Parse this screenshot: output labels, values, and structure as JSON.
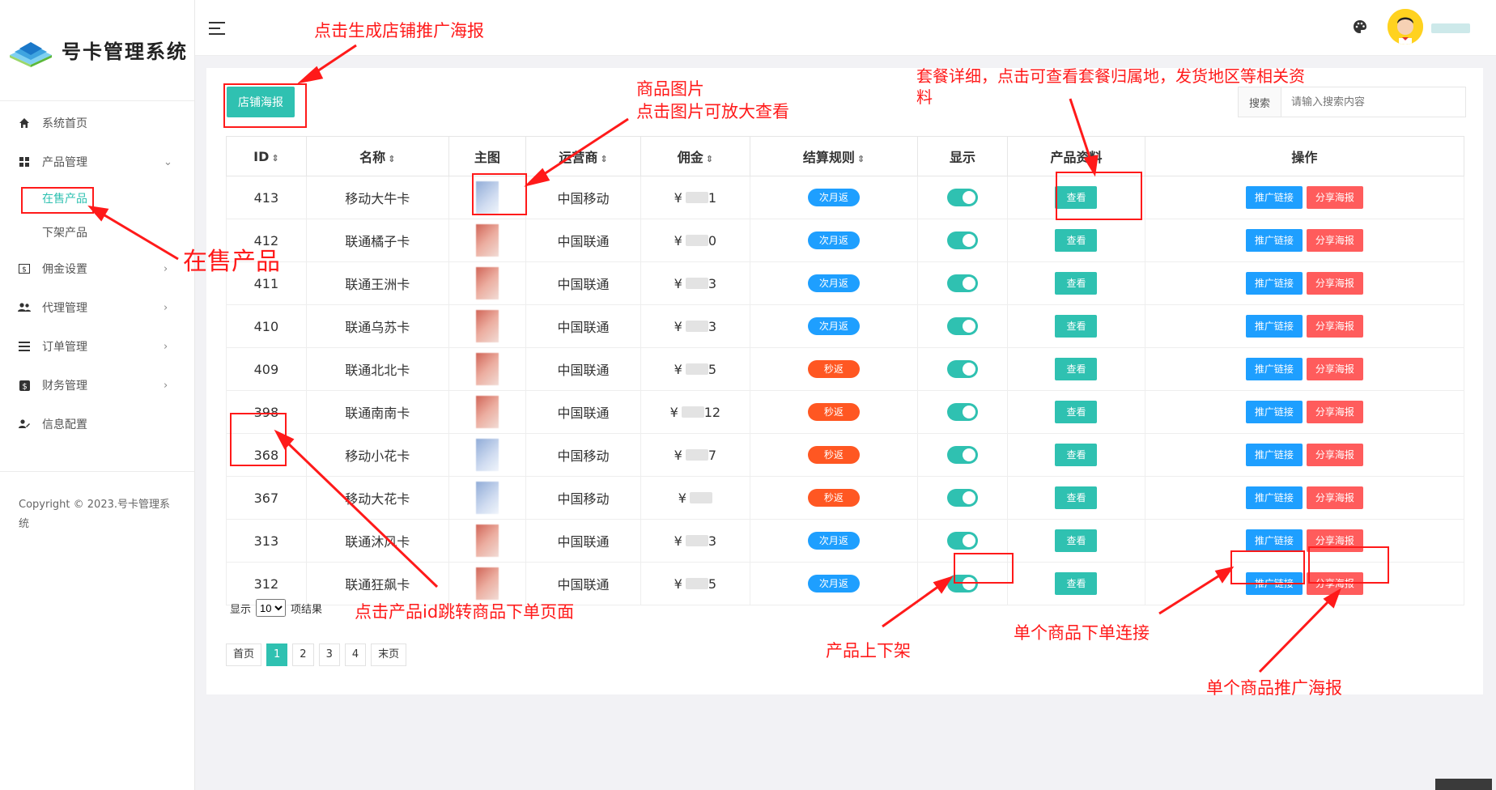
{
  "app": {
    "title": "号卡管理系统"
  },
  "sidebar": {
    "items": [
      {
        "label": "系统首页",
        "icon": "home-icon",
        "arrow": ""
      },
      {
        "label": "产品管理",
        "icon": "grid-icon",
        "arrow": "⌄"
      },
      {
        "label": "佣金设置",
        "icon": "money-icon",
        "arrow": "›"
      },
      {
        "label": "代理管理",
        "icon": "users-icon",
        "arrow": "›"
      },
      {
        "label": "订单管理",
        "icon": "list-icon",
        "arrow": "›"
      },
      {
        "label": "财务管理",
        "icon": "dollar-icon",
        "arrow": "›"
      },
      {
        "label": "信息配置",
        "icon": "user-edit-icon",
        "arrow": ""
      }
    ],
    "sub": [
      "在售产品",
      "下架产品"
    ],
    "copyright": "Copyright © 2023.号卡管理系统"
  },
  "toolbar": {
    "shop_poster": "店铺海报",
    "search_label": "搜索",
    "search_placeholder": "请输入搜索内容"
  },
  "table": {
    "headers": [
      "ID",
      "名称",
      "主图",
      "运营商",
      "佣金",
      "结算规则",
      "显示",
      "产品资料",
      "操作"
    ],
    "view_label": "查看",
    "link_label": "推广链接",
    "poster_label": "分享海报",
    "currency": "¥",
    "rows": [
      {
        "id": "413",
        "name": "移动大牛卡",
        "img": "blue",
        "carrier": "中国移动",
        "rule": "次月返",
        "rule_color": "blue",
        "price": "1"
      },
      {
        "id": "412",
        "name": "联通橘子卡",
        "img": "red",
        "carrier": "中国联通",
        "rule": "次月返",
        "rule_color": "blue",
        "price": "0"
      },
      {
        "id": "411",
        "name": "联通王洲卡",
        "img": "red",
        "carrier": "中国联通",
        "rule": "次月返",
        "rule_color": "blue",
        "price": "3"
      },
      {
        "id": "410",
        "name": "联通乌苏卡",
        "img": "red",
        "carrier": "中国联通",
        "rule": "次月返",
        "rule_color": "blue",
        "price": "3"
      },
      {
        "id": "409",
        "name": "联通北北卡",
        "img": "red",
        "carrier": "中国联通",
        "rule": "秒返",
        "rule_color": "red",
        "price": "5"
      },
      {
        "id": "398",
        "name": "联通南南卡",
        "img": "red",
        "carrier": "中国联通",
        "rule": "秒返",
        "rule_color": "red",
        "price": "12"
      },
      {
        "id": "368",
        "name": "移动小花卡",
        "img": "blue",
        "carrier": "中国移动",
        "rule": "秒返",
        "rule_color": "red",
        "price": "7"
      },
      {
        "id": "367",
        "name": "移动大花卡",
        "img": "blue",
        "carrier": "中国移动",
        "rule": "秒返",
        "rule_color": "red",
        "price": ""
      },
      {
        "id": "313",
        "name": "联通沐风卡",
        "img": "red",
        "carrier": "中国联通",
        "rule": "次月返",
        "rule_color": "blue",
        "price": "3"
      },
      {
        "id": "312",
        "name": "联通狂飙卡",
        "img": "red",
        "carrier": "中国联通",
        "rule": "次月返",
        "rule_color": "blue",
        "price": "5"
      }
    ]
  },
  "pagination": {
    "show": "显示",
    "size": "10",
    "results": "项结果",
    "first": "首页",
    "pages": [
      "1",
      "2",
      "3",
      "4"
    ],
    "last": "末页",
    "current": "1"
  },
  "annotations": {
    "a1": "点击生成店铺推广海报",
    "a2": "商品图片",
    "a3": "点击图片可放大查看",
    "a4": "套餐详细，点击可查看套餐归属地，发货地区等相关资",
    "a4b": "料",
    "a5": "在售产品",
    "a6": "点击产品id跳转商品下单页面",
    "a7": "产品上下架",
    "a8": "单个商品下单连接",
    "a9": "单个商品推广海报"
  }
}
